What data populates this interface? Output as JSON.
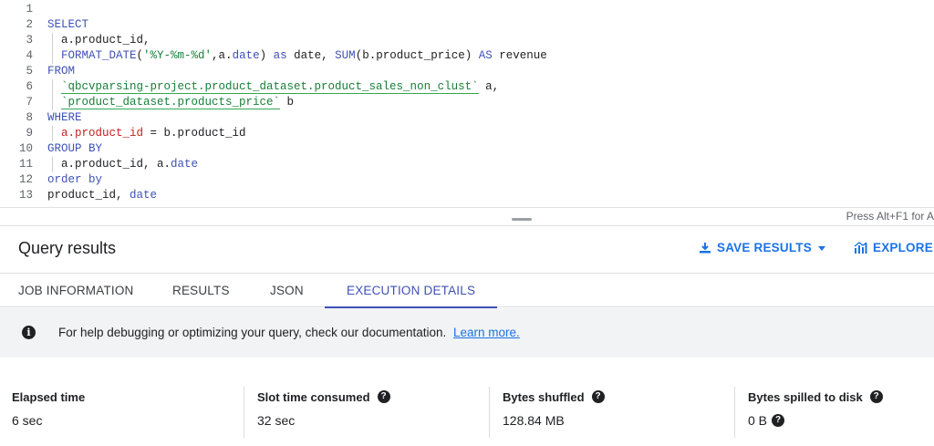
{
  "editor": {
    "line_numbers": [
      "1",
      "2",
      "3",
      "4",
      "5",
      "6",
      "7",
      "8",
      "9",
      "10",
      "11",
      "12",
      "13"
    ],
    "hint": "Press Alt+F1 for A"
  },
  "results": {
    "title": "Query results",
    "save_label": "SAVE RESULTS",
    "explore_label": "EXPLORE D"
  },
  "tabs": [
    "JOB INFORMATION",
    "RESULTS",
    "JSON",
    "EXECUTION DETAILS"
  ],
  "banner": {
    "text": "For help debugging or optimizing your query, check our documentation.",
    "link": "Learn more."
  },
  "stats": [
    {
      "label": "Elapsed time",
      "value": "6 sec"
    },
    {
      "label": "Slot time consumed",
      "value": "32 sec"
    },
    {
      "label": "Bytes shuffled",
      "value": "128.84 MB"
    },
    {
      "label": "Bytes spilled to disk",
      "value": "0 B"
    }
  ],
  "colors": {
    "accent": "#1a73e8",
    "tab_active": "#3f51b5",
    "keyword": "#3f51b5",
    "string": "#188038",
    "banner_bg": "#f1f3f4"
  },
  "code": {
    "l2": "SELECT",
    "l3": "a.product_id,",
    "l4_fn1": "FORMAT_DATE",
    "l4_open": "(",
    "l4_str": "'%Y-%m-%d'",
    "l4_mid": ",a.",
    "l4_date": "date",
    "l4_close": ")",
    "l4_as": "as",
    "l4_alias": "date,",
    "l4_fn2": "SUM",
    "l4_arg": "(b.product_price)",
    "l4_AS": "AS",
    "l4_rev": "revenue",
    "l5": "FROM",
    "l6_tbl": "`qbcvparsing-project.product_dataset.product_sales_non_clust`",
    "l6_alias": " a,",
    "l7_tbl": "`product_dataset.products_price`",
    "l7_alias": " b",
    "l8": "WHERE",
    "l9_left": "a.product_id",
    "l9_rest": " = b.product_id",
    "l10": "GROUP BY",
    "l11_a": "a.product_id, a.",
    "l11_date": "date",
    "l12": "order by",
    "l13_a": "product_id, ",
    "l13_date": "date"
  }
}
